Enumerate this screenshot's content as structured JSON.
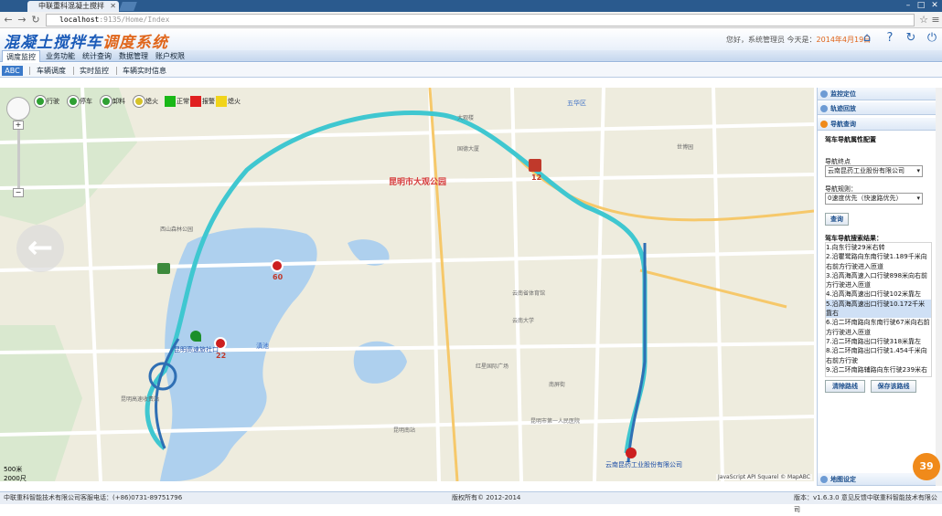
{
  "browser": {
    "tab_title": "中联重科混凝土搅拌",
    "url_host": "localhost",
    "url_path": ":9135/Home/Index"
  },
  "app": {
    "logo_main": "混凝土搅拌车",
    "logo_accent": "调度系统",
    "greeting": "您好，系统管理员 今天是：",
    "date": "2014年4月19日",
    "accent_color": "#1a5ab8",
    "orange": "#e0651a"
  },
  "menu": [
    {
      "label": "调度监控",
      "active": true
    },
    {
      "label": "业务功能"
    },
    {
      "label": "统计查询"
    },
    {
      "label": "数据管理"
    },
    {
      "label": "账户权限"
    }
  ],
  "submenu": {
    "abc": "ABC",
    "items": [
      "车辆调度",
      "实时监控",
      "车辆实时信息"
    ]
  },
  "legend": [
    {
      "label": "行驶",
      "color": "#2fa033",
      "icon": "A"
    },
    {
      "label": "停车",
      "color": "#2fa033",
      "icon": "stop"
    },
    {
      "label": "卸料",
      "color": "#2fa033",
      "icon": "unload"
    },
    {
      "label": "熄火",
      "color": "#d5c22a",
      "icon": "off"
    },
    {
      "label": "正常",
      "color": "#19b817",
      "icon": "square"
    },
    {
      "label": "报警",
      "color": "#e02020",
      "icon": "square"
    },
    {
      "label": "熄火",
      "color": "#f1d41a",
      "icon": "square"
    }
  ],
  "map": {
    "labels": {
      "lake": "昆明市大观公园",
      "gaode": "国德大厦",
      "district": "五华区",
      "wulou": "大观楼",
      "xishan": "西山森林公园",
      "dianchi": "滇池",
      "yunnanhotel": "云南大学",
      "hospital": "昆明市第一人民医院",
      "honghe": "红星国际广场",
      "station": "昆明南站",
      "bridge": "昆明高速收费站",
      "gym": "云南省体育馆",
      "nanping": "南屏街",
      "shijie": "世博园"
    },
    "vehicles": [
      {
        "id": "12",
        "color": "#c0392b"
      },
      {
        "id": "60",
        "color": "#cc1f1f"
      },
      {
        "id": "22",
        "color": "#cc1f1f"
      }
    ],
    "start_label": "昆明高速旅社口",
    "end_label": "云南昆药工业股份有限公司",
    "scale_1": "500米",
    "scale_2": "2000尺",
    "copyright": "JavaScript API Squarel © MapABC",
    "badge_count": "39"
  },
  "panel": {
    "sections": {
      "monitor": "监控定位",
      "track": "轨迹回放",
      "nav": "导航查询",
      "map_settings": "地图设定"
    },
    "nav_config_label": "驾车导航属性配置",
    "dest_label": "导航终点",
    "dest_value": "云南昆药工业股份有限公司",
    "rule_label": "导航规则：",
    "rule_value": "0速度优先（快速路优先）",
    "query_btn": "查询",
    "result_label": "驾车导航搜索结果：",
    "result_rows": [
      "1.向东行驶29米右转",
      "2.沿瞿鹭路向东南行驶1.189千米向右前方行驶进入匝道",
      "3.沿高海高速入口行驶898米向右前方行驶进入匝道",
      "4.沿高海高速出口行驶102米靠左",
      "5.沿高海高速出口行驶10.172千米靠右",
      "6.沿二环南路向东南行驶67米向右前方行驶进入匝道",
      "7.沿二环南路出口行驶318米靠左",
      "8.沿二环南路出口行驶1.454千米向右前方行驶",
      "9.沿二环南路辅路向东行驶239米右"
    ],
    "clear_btn": "清除路线",
    "save_btn": "保存该路线"
  },
  "footer": {
    "left": "中联重科智能技术有限公司客服电话：(+86)0731-89751796",
    "center": "版权所有© 2012-2014",
    "right": "版本：v1.6.3.0 意见反馈中联重科智能技术有限公司"
  }
}
